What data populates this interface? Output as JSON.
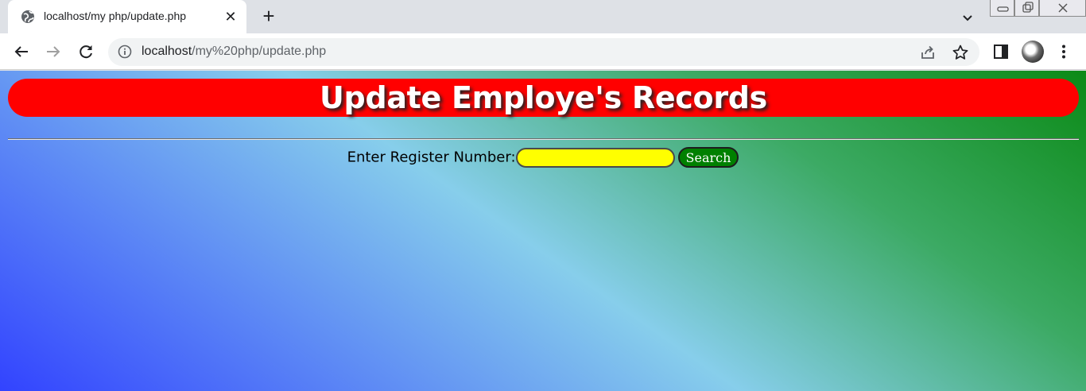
{
  "browser": {
    "tab_title": "localhost/my php/update.php",
    "url_host": "localhost",
    "url_path": "/my%20php/update.php"
  },
  "page": {
    "heading": "Update Employe's Records",
    "form_label": "Enter Register Number:",
    "input_value": "",
    "search_label": "Search"
  },
  "colors": {
    "banner": "#ff0000",
    "input_bg": "#ffff00",
    "button_bg": "#008000",
    "gradient": [
      "#3243ff",
      "#87ceeb",
      "#3caa64",
      "#0b8a16"
    ]
  },
  "icons": [
    "globe-icon",
    "close-icon",
    "plus-icon",
    "chevron-down-icon",
    "back-arrow-icon",
    "forward-arrow-icon",
    "reload-icon",
    "info-icon",
    "share-icon",
    "star-icon",
    "side-panel-icon",
    "avatar",
    "more-vert-icon"
  ]
}
